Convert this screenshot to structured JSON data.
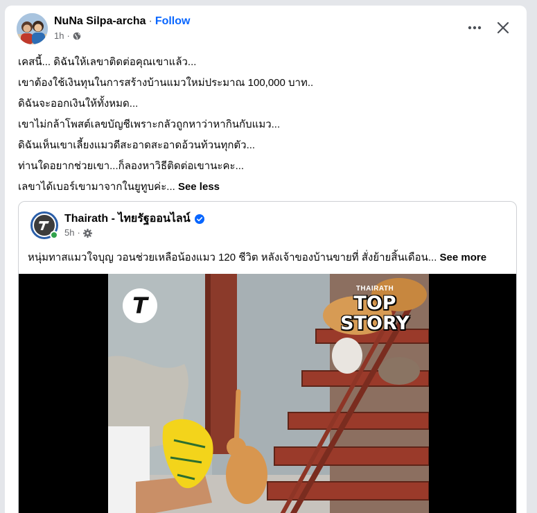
{
  "post": {
    "author": "NuNa Silpa-archa",
    "separator": "·",
    "follow_label": "Follow",
    "time": "1h",
    "privacy_icon": "globe-icon",
    "more_icon": "more-horizontal-icon",
    "close_icon": "close-icon",
    "lines": [
      "เคสนี้... ดิฉันให้เลขาติดต่อคุณเขาแล้ว...",
      "เขาต้องใช้เงินทุนในการสร้างบ้านแมวใหม่ประมาณ 100,000 บาท..",
      "ดิฉันจะออกเงินให้ทั้งหมด...",
      "เขาไม่กล้าโพสต์เลขบัญชีเพราะกลัวถูกหาว่าหากินกับแมว...",
      "ดิฉันเห็นเขาเลี้ยงแมวดีสะอาดสะอาดอ้วนท้วนทุกตัว...",
      "ท่านใดอยากช่วยเขา...ก็ลองหาวิธีติดต่อเขานะคะ...",
      "เลขาได้เบอร์เขามาจากในยูทูบค่ะ..."
    ],
    "see_less_label": "See less"
  },
  "shared": {
    "page_name": "Thairath - ไทยรัฐออนไลน์",
    "verified_icon": "verified-badge-icon",
    "time": "5h",
    "audience_icon": "settings-gear-icon",
    "text": "หนุ่มทาสแมวใจบุญ วอนช่วยเหลือน้องแมว 120 ชีวิต หลังเจ้าของบ้านขายที่ สั่งย้ายสิ้นเดือน...",
    "see_more_label": "See more",
    "video": {
      "brand_letter": "T",
      "badge_small": "THAIRATH",
      "badge_line1": "TOP",
      "badge_line2": "STORY"
    }
  },
  "colors": {
    "link": "#0866ff",
    "secondary_text": "#65676b",
    "online": "#31a24c",
    "verified": "#0866ff"
  }
}
